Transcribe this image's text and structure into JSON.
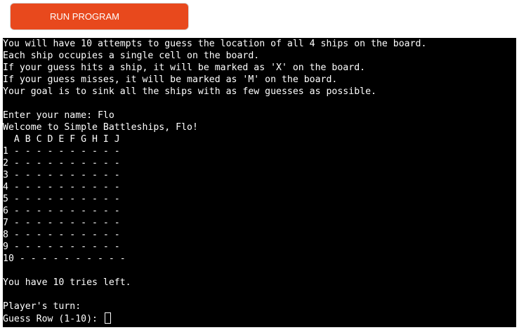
{
  "toolbar": {
    "run_label": "RUN PROGRAM"
  },
  "terminal": {
    "lines": [
      "You will have 10 attempts to guess the location of all 4 ships on the board.",
      "Each ship occupies a single cell on the board.",
      "If your guess hits a ship, it will be marked as 'X' on the board.",
      "If your guess misses, it will be marked as 'M' on the board.",
      "Your goal is to sink all the ships with as few guesses as possible.",
      "",
      "Enter your name: Flo",
      "Welcome to Simple Battleships, Flo!",
      "  A B C D E F G H I J",
      "1 - - - - - - - - - -",
      "2 - - - - - - - - - -",
      "3 - - - - - - - - - -",
      "4 - - - - - - - - - -",
      "5 - - - - - - - - - -",
      "6 - - - - - - - - - -",
      "7 - - - - - - - - - -",
      "8 - - - - - - - - - -",
      "9 - - - - - - - - - -",
      "10 - - - - - - - - - -",
      "",
      "You have 10 tries left.",
      "",
      "Player's turn:"
    ],
    "prompt": "Guess Row (1-10): "
  }
}
